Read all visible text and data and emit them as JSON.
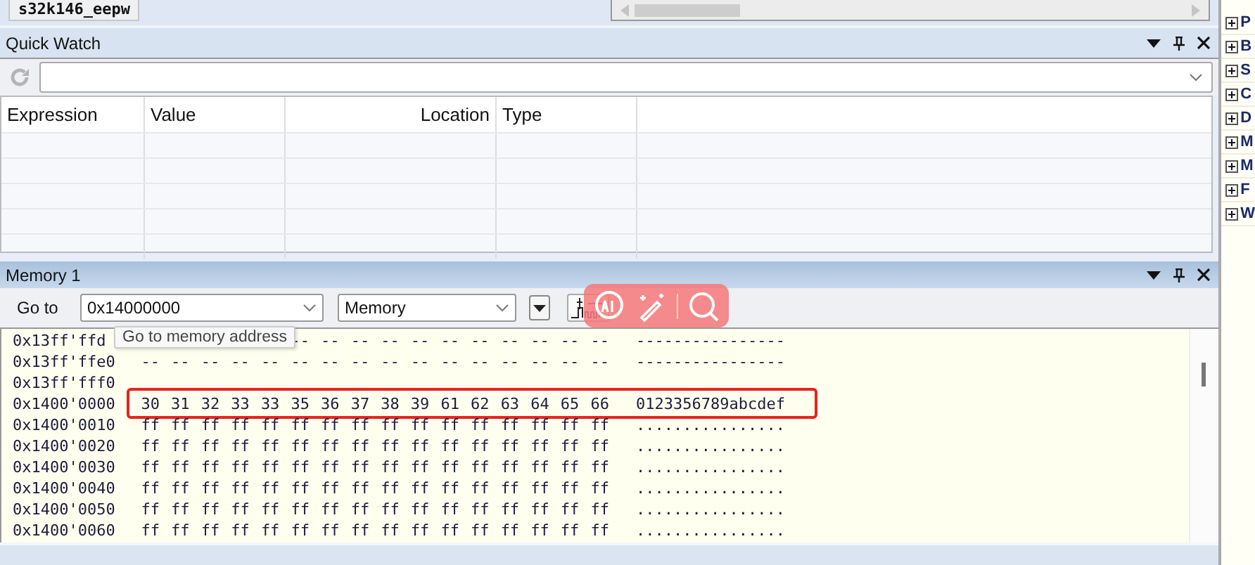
{
  "top_panel": {
    "project_tab": "s32k146_eepw"
  },
  "quick_watch": {
    "title": "Quick Watch",
    "columns": [
      "Expression",
      "Value",
      "Location",
      "Type"
    ]
  },
  "memory": {
    "title": "Memory 1",
    "goto_label": "Go to",
    "address_value": "0x14000000",
    "tooltip": "Go to memory address",
    "space_value": "Memory",
    "rows": [
      {
        "address": "0x13ff'ffd",
        "bytes": [
          "--",
          "--",
          "--",
          "--",
          "--",
          "--",
          "--",
          "--",
          "--",
          "--",
          "--"
        ],
        "ascii": "----------------",
        "highlighted": false
      },
      {
        "address": "0x13ff'ffe0",
        "bytes": [
          "--",
          "--",
          "--",
          "--",
          "--",
          "--",
          "--",
          "--",
          "--",
          "--",
          "--",
          "--",
          "--",
          "--",
          "--",
          "--"
        ],
        "ascii": "----------------",
        "highlighted": false
      },
      {
        "address": "0x13ff'fff0",
        "highlighted": false
      },
      {
        "address": "0x1400'0000",
        "bytes": [
          "30",
          "31",
          "32",
          "33",
          "33",
          "35",
          "36",
          "37",
          "38",
          "39",
          "61",
          "62",
          "63",
          "64",
          "65",
          "66"
        ],
        "ascii": "0123356789abcdef",
        "highlighted": true
      },
      {
        "address": "0x1400'0010",
        "bytes": [
          "ff",
          "ff",
          "ff",
          "ff",
          "ff",
          "ff",
          "ff",
          "ff",
          "ff",
          "ff",
          "ff",
          "ff",
          "ff",
          "ff",
          "ff",
          "ff"
        ],
        "ascii": "................",
        "highlighted": false
      },
      {
        "address": "0x1400'0020",
        "bytes": [
          "ff",
          "ff",
          "ff",
          "ff",
          "ff",
          "ff",
          "ff",
          "ff",
          "ff",
          "ff",
          "ff",
          "ff",
          "ff",
          "ff",
          "ff",
          "ff"
        ],
        "ascii": "................",
        "highlighted": false
      },
      {
        "address": "0x1400'0030",
        "bytes": [
          "ff",
          "ff",
          "ff",
          "ff",
          "ff",
          "ff",
          "ff",
          "ff",
          "ff",
          "ff",
          "ff",
          "ff",
          "ff",
          "ff",
          "ff",
          "ff"
        ],
        "ascii": "................",
        "highlighted": false
      },
      {
        "address": "0x1400'0040",
        "bytes": [
          "ff",
          "ff",
          "ff",
          "ff",
          "ff",
          "ff",
          "ff",
          "ff",
          "ff",
          "ff",
          "ff",
          "ff",
          "ff",
          "ff",
          "ff",
          "ff"
        ],
        "ascii": "................",
        "highlighted": false
      },
      {
        "address": "0x1400'0050",
        "bytes": [
          "ff",
          "ff",
          "ff",
          "ff",
          "ff",
          "ff",
          "ff",
          "ff",
          "ff",
          "ff",
          "ff",
          "ff",
          "ff",
          "ff",
          "ff",
          "ff"
        ],
        "ascii": "................",
        "highlighted": false
      },
      {
        "address": "0x1400'0060",
        "bytes": [
          "ff",
          "ff",
          "ff",
          "ff",
          "ff",
          "ff",
          "ff",
          "ff",
          "ff",
          "ff",
          "ff",
          "ff",
          "ff",
          "ff",
          "ff",
          "ff"
        ],
        "ascii": "................",
        "highlighted": false
      }
    ]
  },
  "side_tree": {
    "items": [
      {
        "label": "P",
        "expanded": false
      },
      {
        "label": "B",
        "expanded": false
      },
      {
        "label": "S",
        "expanded": false
      },
      {
        "label": "C",
        "expanded": false
      },
      {
        "label": "D",
        "expanded": false
      },
      {
        "label": "M",
        "expanded": false
      },
      {
        "label": "M",
        "expanded": false
      },
      {
        "label": "F",
        "expanded": false
      },
      {
        "label": "W",
        "expanded": false
      }
    ]
  }
}
